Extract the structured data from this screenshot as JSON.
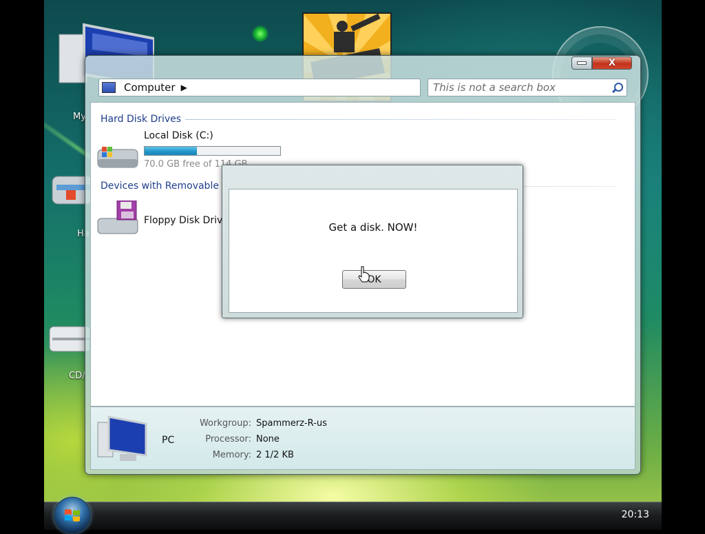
{
  "desktop": {
    "icons": [
      {
        "name": "my-computer-desktop-icon",
        "label": "My"
      },
      {
        "name": "hard-disk-desktop-icon",
        "label": "Ha"
      },
      {
        "name": "cd-drive-desktop-icon",
        "label": "CD/"
      }
    ],
    "tank_icon_name": "tank-game-icon",
    "accent_colors": {
      "title_close": "#c2321a",
      "capacity_bar": "#2094c9",
      "group_header": "#1d3d8a"
    }
  },
  "window": {
    "address": {
      "location": "Computer"
    },
    "search": {
      "placeholder": "This is not a search box"
    },
    "caption": {
      "close_glyph": "X"
    },
    "groups": {
      "hard_disk_drives": {
        "title": "Hard Disk Drives",
        "local_disk": {
          "name": "Local Disk (C:)",
          "free_text": "70.0 GB free of 114 GB",
          "used_fraction": 0.386
        }
      },
      "removable": {
        "title": "Devices with Removable Storage",
        "floppy": {
          "name": "Floppy Disk Drive (A:)"
        }
      }
    },
    "details": {
      "pc_name": "PC",
      "workgroup": {
        "label": "Workgroup:",
        "value": "Spammerz-R-us"
      },
      "processor": {
        "label": "Processor:",
        "value": "None"
      },
      "memory": {
        "label": "Memory:",
        "value": "2 1/2 KB"
      }
    }
  },
  "dialog": {
    "message": "Get a disk. NOW!",
    "ok_label": "OK"
  },
  "taskbar": {
    "clock": "20:13"
  }
}
